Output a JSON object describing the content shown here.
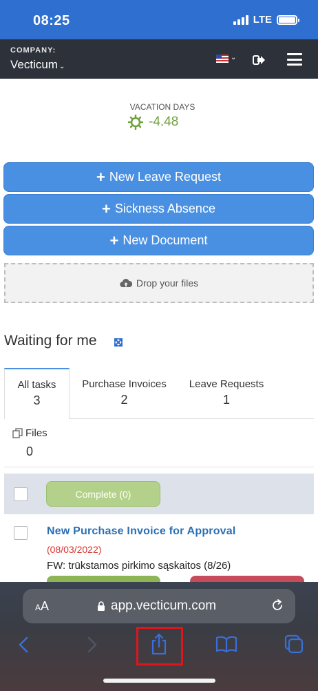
{
  "status_bar": {
    "time": "08:25",
    "network": "LTE"
  },
  "header": {
    "company_label": "COMPANY:",
    "company_name": "Vecticum"
  },
  "vacation": {
    "label": "VACATION DAYS",
    "value": "-4.48"
  },
  "actions": {
    "new_leave": "New Leave Request",
    "sickness": "Sickness Absence",
    "new_document": "New Document",
    "drop_files": "Drop your files"
  },
  "waiting": {
    "title": "Waiting for me",
    "tabs": [
      {
        "label": "All tasks",
        "count": "3"
      },
      {
        "label": "Purchase Invoices",
        "count": "2"
      },
      {
        "label": "Leave Requests",
        "count": "1"
      },
      {
        "label": "Files",
        "count": "0"
      }
    ],
    "complete_label": "Complete (0)"
  },
  "task": {
    "title": "New Purchase Invoice for Approval",
    "date": "(08/03/2022)",
    "description": "FW: trūkstamos pirkimo sąskaitos (8/26)"
  },
  "browser": {
    "aa_label": "AA",
    "url": "app.vecticum.com"
  },
  "colors": {
    "status_bar": "#2e6fd0",
    "header": "#2c313a",
    "primary_button": "#4a90e2",
    "vacation_green": "#6fa03d",
    "task_link": "#2a6fb3",
    "task_date": "#d9322b",
    "complete_button": "#b3d18a",
    "highlight_box": "#e0151b",
    "safari_tint": "#3a6fd8"
  }
}
